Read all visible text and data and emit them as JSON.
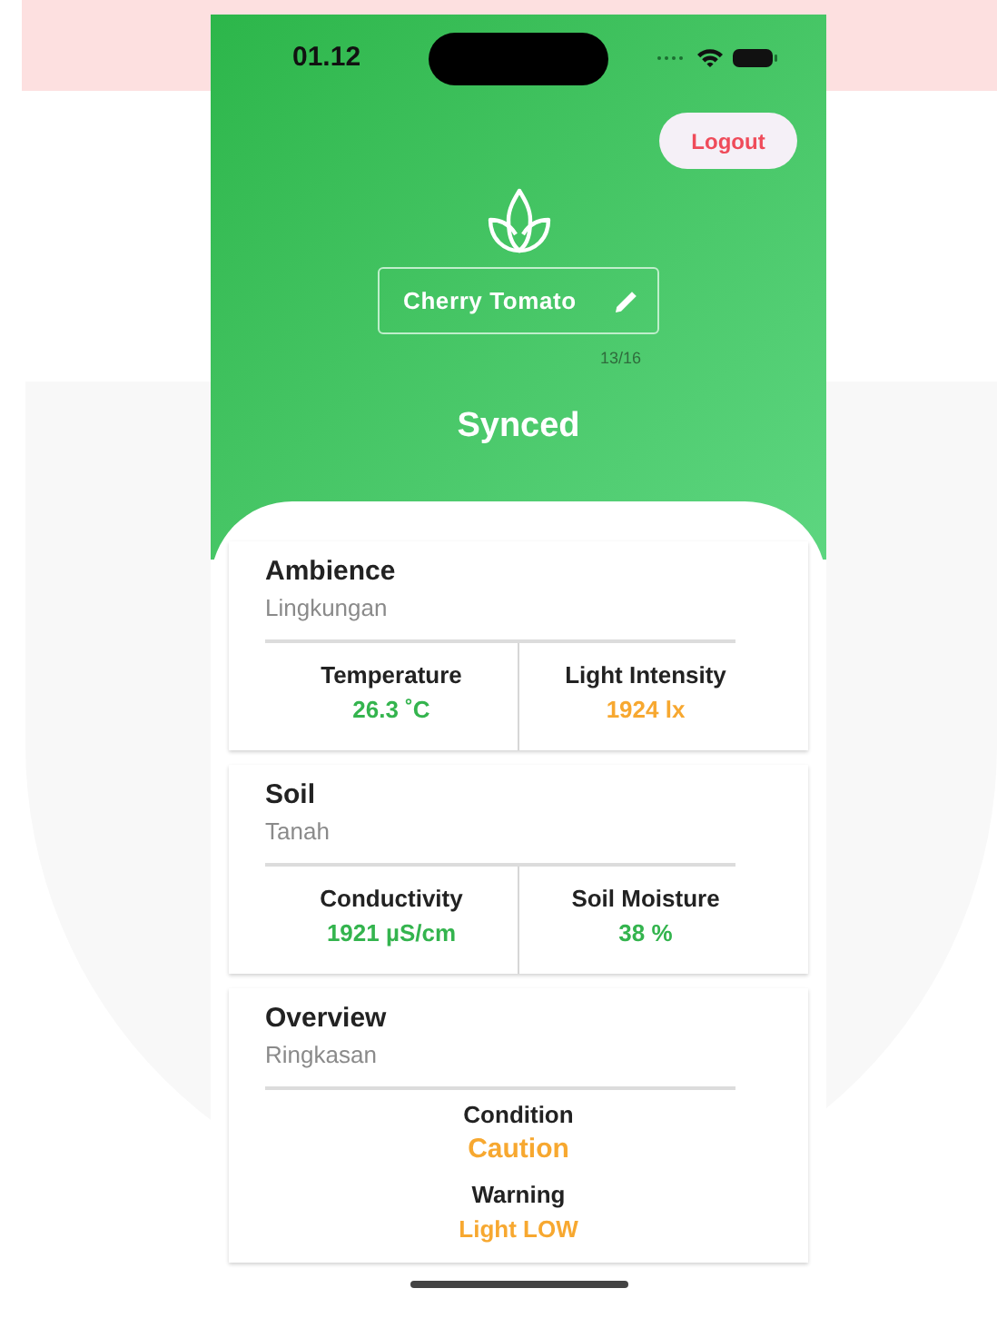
{
  "status_bar": {
    "time": "01.12"
  },
  "logout": {
    "label": "Logout"
  },
  "plant_name": {
    "value": "Cherry Tomato",
    "counter": "13/16"
  },
  "sync_status": "Synced",
  "sections": [
    {
      "title": "Ambience",
      "subtitle": "Lingkungan",
      "kind": "pair",
      "metrics": [
        {
          "label": "Temperature",
          "value": "26.3 ˚C",
          "color": "#34b44e"
        },
        {
          "label": "Light Intensity",
          "value": "1924 lx",
          "color": "#f7a830"
        }
      ]
    },
    {
      "title": "Soil",
      "subtitle": "Tanah",
      "kind": "pair",
      "metrics": [
        {
          "label": "Conductivity",
          "value": "1921 µS/cm",
          "color": "#34b44e"
        },
        {
          "label": "Soil Moisture",
          "value": "38 %",
          "color": "#34b44e"
        }
      ]
    },
    {
      "title": "Overview",
      "subtitle": "Ringkasan",
      "kind": "stack",
      "metrics": [
        {
          "label": "Condition",
          "value": "Caution",
          "color": "#f7a830"
        },
        {
          "label": "Warning",
          "value": "Light LOW",
          "color": "#f7a830"
        }
      ]
    }
  ]
}
